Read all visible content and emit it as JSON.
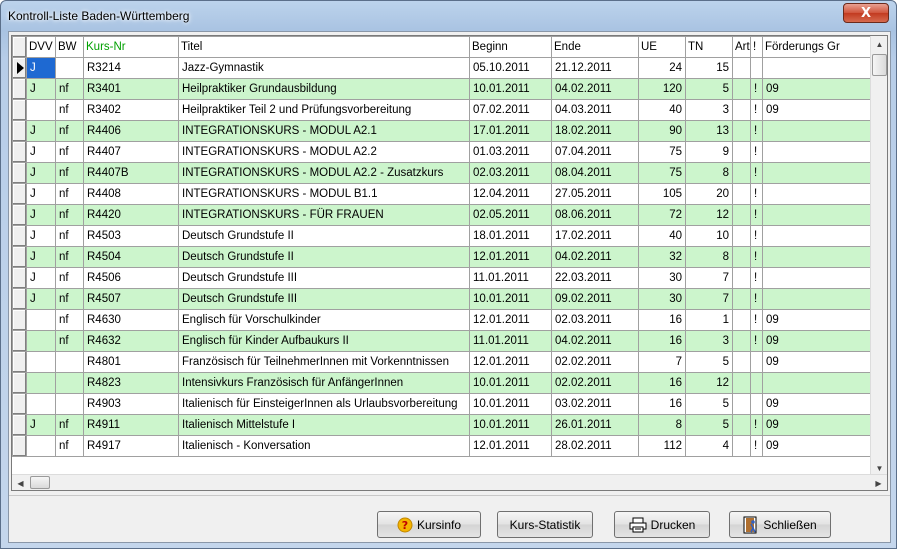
{
  "window": {
    "title": "Kontroll-Liste Baden-Württemberg",
    "close_glyph": "X"
  },
  "columns": [
    "DVV",
    "BW",
    "Kurs-Nr",
    "Titel",
    "Beginn",
    "Ende",
    "UE",
    "TN",
    "Art",
    "!",
    "Förderungs Gr"
  ],
  "rows": [
    {
      "dvv": "J",
      "bw": "",
      "kurs": "R3214",
      "titel": "Jazz-Gymnastik",
      "beginn": "05.10.2011",
      "ende": "21.12.2011",
      "ue": "24",
      "tn": "15",
      "art": "",
      "flag": "",
      "foerd": "",
      "green": false,
      "selected": true
    },
    {
      "dvv": "J",
      "bw": "nf",
      "kurs": "R3401",
      "titel": "Heilpraktiker Grundausbildung",
      "beginn": "10.01.2011",
      "ende": "04.02.2011",
      "ue": "120",
      "tn": "5",
      "art": "",
      "flag": "!",
      "foerd": "09",
      "green": true
    },
    {
      "dvv": "",
      "bw": "nf",
      "kurs": "R3402",
      "titel": "Heilpraktiker Teil 2 und Prüfungsvorbereitung",
      "beginn": "07.02.2011",
      "ende": "04.03.2011",
      "ue": "40",
      "tn": "3",
      "art": "",
      "flag": "!",
      "foerd": "09",
      "green": false
    },
    {
      "dvv": "J",
      "bw": "nf",
      "kurs": "R4406",
      "titel": "INTEGRATIONSKURS - MODUL A2.1",
      "beginn": "17.01.2011",
      "ende": "18.02.2011",
      "ue": "90",
      "tn": "13",
      "art": "",
      "flag": "!",
      "foerd": "",
      "green": true
    },
    {
      "dvv": "J",
      "bw": "nf",
      "kurs": "R4407",
      "titel": "INTEGRATIONSKURS - MODUL A2.2",
      "beginn": "01.03.2011",
      "ende": "07.04.2011",
      "ue": "75",
      "tn": "9",
      "art": "",
      "flag": "!",
      "foerd": "",
      "green": false
    },
    {
      "dvv": "J",
      "bw": "nf",
      "kurs": "R4407B",
      "titel": "INTEGRATIONSKURS - MODUL A2.2 - Zusatzkurs",
      "beginn": "02.03.2011",
      "ende": "08.04.2011",
      "ue": "75",
      "tn": "8",
      "art": "",
      "flag": "!",
      "foerd": "",
      "green": true
    },
    {
      "dvv": "J",
      "bw": "nf",
      "kurs": "R4408",
      "titel": "INTEGRATIONSKURS - MODUL B1.1",
      "beginn": "12.04.2011",
      "ende": "27.05.2011",
      "ue": "105",
      "tn": "20",
      "art": "",
      "flag": "!",
      "foerd": "",
      "green": false
    },
    {
      "dvv": "J",
      "bw": "nf",
      "kurs": "R4420",
      "titel": "INTEGRATIONSKURS - FÜR FRAUEN",
      "beginn": "02.05.2011",
      "ende": "08.06.2011",
      "ue": "72",
      "tn": "12",
      "art": "",
      "flag": "!",
      "foerd": "",
      "green": true
    },
    {
      "dvv": "J",
      "bw": "nf",
      "kurs": "R4503",
      "titel": "Deutsch Grundstufe II",
      "beginn": "18.01.2011",
      "ende": "17.02.2011",
      "ue": "40",
      "tn": "10",
      "art": "",
      "flag": "!",
      "foerd": "",
      "green": false
    },
    {
      "dvv": "J",
      "bw": "nf",
      "kurs": "R4504",
      "titel": "Deutsch Grundstufe II",
      "beginn": "12.01.2011",
      "ende": "04.02.2011",
      "ue": "32",
      "tn": "8",
      "art": "",
      "flag": "!",
      "foerd": "",
      "green": true
    },
    {
      "dvv": "J",
      "bw": "nf",
      "kurs": "R4506",
      "titel": "Deutsch Grundstufe III",
      "beginn": "11.01.2011",
      "ende": "22.03.2011",
      "ue": "30",
      "tn": "7",
      "art": "",
      "flag": "!",
      "foerd": "",
      "green": false
    },
    {
      "dvv": "J",
      "bw": "nf",
      "kurs": "R4507",
      "titel": "Deutsch Grundstufe III",
      "beginn": "10.01.2011",
      "ende": "09.02.2011",
      "ue": "30",
      "tn": "7",
      "art": "",
      "flag": "!",
      "foerd": "",
      "green": true
    },
    {
      "dvv": "",
      "bw": "nf",
      "kurs": "R4630",
      "titel": "Englisch für Vorschulkinder",
      "beginn": "12.01.2011",
      "ende": "02.03.2011",
      "ue": "16",
      "tn": "1",
      "art": "",
      "flag": "!",
      "foerd": "09",
      "green": false
    },
    {
      "dvv": "",
      "bw": "nf",
      "kurs": "R4632",
      "titel": "Englisch für Kinder Aufbaukurs II",
      "beginn": "11.01.2011",
      "ende": "04.02.2011",
      "ue": "16",
      "tn": "3",
      "art": "",
      "flag": "!",
      "foerd": "09",
      "green": true
    },
    {
      "dvv": "",
      "bw": "",
      "kurs": "R4801",
      "titel": "Französisch für TeilnehmerInnen mit Vorkenntnissen",
      "beginn": "12.01.2011",
      "ende": "02.02.2011",
      "ue": "7",
      "tn": "5",
      "art": "",
      "flag": "",
      "foerd": "09",
      "green": false
    },
    {
      "dvv": "",
      "bw": "",
      "kurs": "R4823",
      "titel": "Intensivkurs Französisch für AnfängerInnen",
      "beginn": "10.01.2011",
      "ende": "02.02.2011",
      "ue": "16",
      "tn": "12",
      "art": "",
      "flag": "",
      "foerd": "",
      "green": true
    },
    {
      "dvv": "",
      "bw": "",
      "kurs": "R4903",
      "titel": "Italienisch für EinsteigerInnen als Urlaubsvorbereitung",
      "beginn": "10.01.2011",
      "ende": "03.02.2011",
      "ue": "16",
      "tn": "5",
      "art": "",
      "flag": "",
      "foerd": "09",
      "green": false
    },
    {
      "dvv": "J",
      "bw": "nf",
      "kurs": "R4911",
      "titel": "Italienisch Mittelstufe I",
      "beginn": "10.01.2011",
      "ende": "26.01.2011",
      "ue": "8",
      "tn": "5",
      "art": "",
      "flag": "!",
      "foerd": "09",
      "green": true
    },
    {
      "dvv": "",
      "bw": "nf",
      "kurs": "R4917",
      "titel": "Italienisch - Konversation",
      "beginn": "12.01.2011",
      "ende": "28.02.2011",
      "ue": "112",
      "tn": "4",
      "art": "",
      "flag": "!",
      "foerd": "09",
      "green": false
    }
  ],
  "buttons": {
    "kursinfo": "Kursinfo",
    "statistik": "Kurs-Statistik",
    "drucken": "Drucken",
    "schliessen": "Schließen"
  },
  "colors": {
    "row_green": "#ccf5cc",
    "selection": "#1e69d2",
    "kurs_header": "#00a000"
  },
  "icons": {
    "kursinfo": "help-icon",
    "drucken": "printer-icon",
    "schliessen": "exit-icon"
  }
}
